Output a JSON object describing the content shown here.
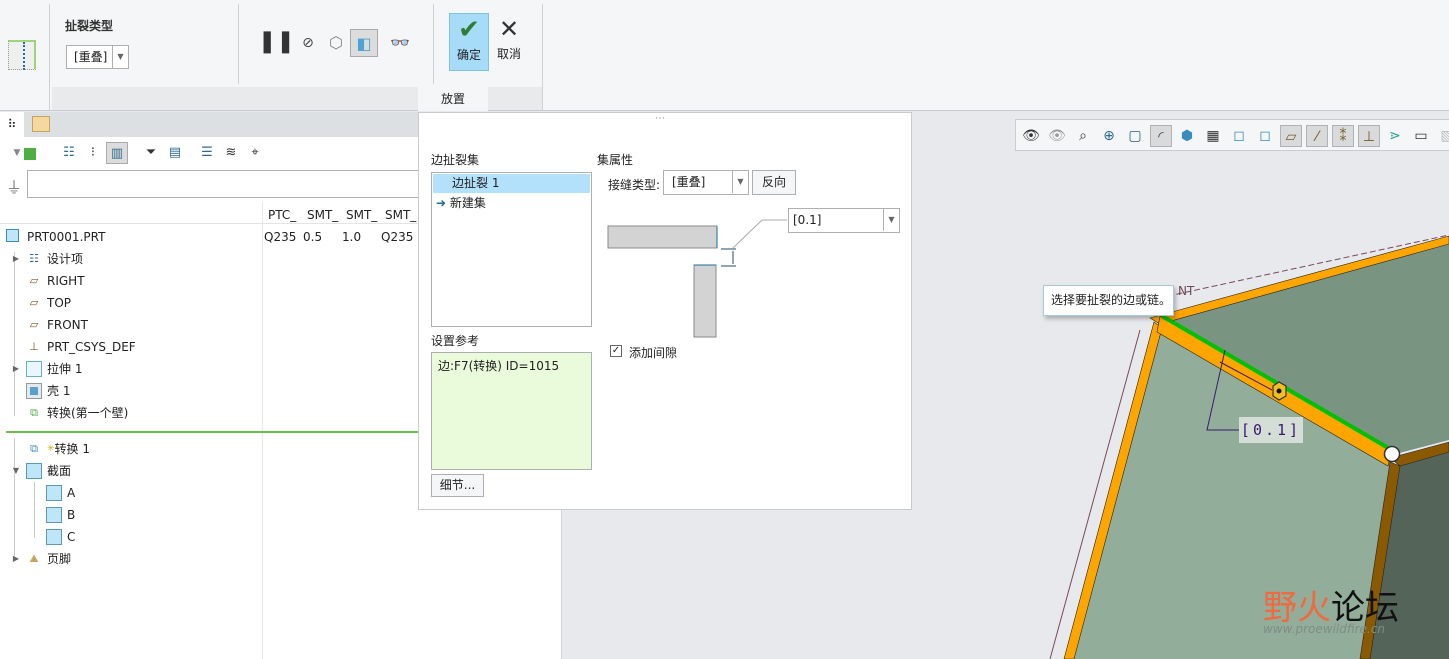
{
  "ribbon": {
    "tear_type_label": "扯裂类型",
    "tear_type_value": "[重叠]",
    "ok_label": "确定",
    "cancel_label": "取消",
    "tab_placement": "放置"
  },
  "model_tree": {
    "columns": [
      "PTC_",
      "SMT_",
      "SMT_",
      "SMT_"
    ],
    "root": {
      "name": "PRT0001.PRT",
      "values": [
        "Q235",
        "0.5",
        "1.0",
        "Q235"
      ]
    },
    "items": [
      {
        "label": "设计项",
        "icon": "design-items-icon"
      },
      {
        "label": "RIGHT",
        "icon": "datum-plane-icon"
      },
      {
        "label": "TOP",
        "icon": "datum-plane-icon"
      },
      {
        "label": "FRONT",
        "icon": "datum-plane-icon"
      },
      {
        "label": "PRT_CSYS_DEF",
        "icon": "csys-icon"
      },
      {
        "label": "拉伸 1",
        "icon": "extrude-icon"
      },
      {
        "label": "壳 1",
        "icon": "shell-icon"
      },
      {
        "label": "转换(第一个壁)",
        "icon": "convert-icon"
      }
    ],
    "insert_items": [
      {
        "label": "转换 1",
        "prefix": "✳",
        "icon": "convert-feature-icon"
      },
      {
        "label": "截面",
        "icon": "section-icon"
      },
      {
        "label": "A",
        "icon": "section-icon"
      },
      {
        "label": "B",
        "icon": "section-icon"
      },
      {
        "label": "C",
        "icon": "section-icon"
      },
      {
        "label": "页脚",
        "icon": "footer-icon"
      }
    ]
  },
  "placement_panel": {
    "edge_rip_sets_label": "边扯裂集",
    "sets": [
      "边扯裂 1",
      "新建集"
    ],
    "set_reference_label": "设置参考",
    "reference_value": "边:F7(转换) ID=1015",
    "details_button": "细节...",
    "set_properties_label": "集属性",
    "seam_type_label": "接缝类型:",
    "seam_type_value": "[重叠]",
    "flip_button": "反向",
    "gap_value": "[0.1]",
    "add_gap_label": "添加间隙",
    "add_gap_checked": true
  },
  "viewport": {
    "tooltip": "选择要扯裂的边或链。",
    "dimension_label": "[0.1]",
    "datum_label": "NT",
    "watermark": "野火论坛",
    "watermark_url": "www.proewildfire.cn"
  },
  "colors": {
    "accent": "#a6dcf7",
    "selection": "#b3e0fb",
    "edge_highlight": "#ffa500",
    "chain_green": "#00c000",
    "face": "#92ae9a"
  }
}
